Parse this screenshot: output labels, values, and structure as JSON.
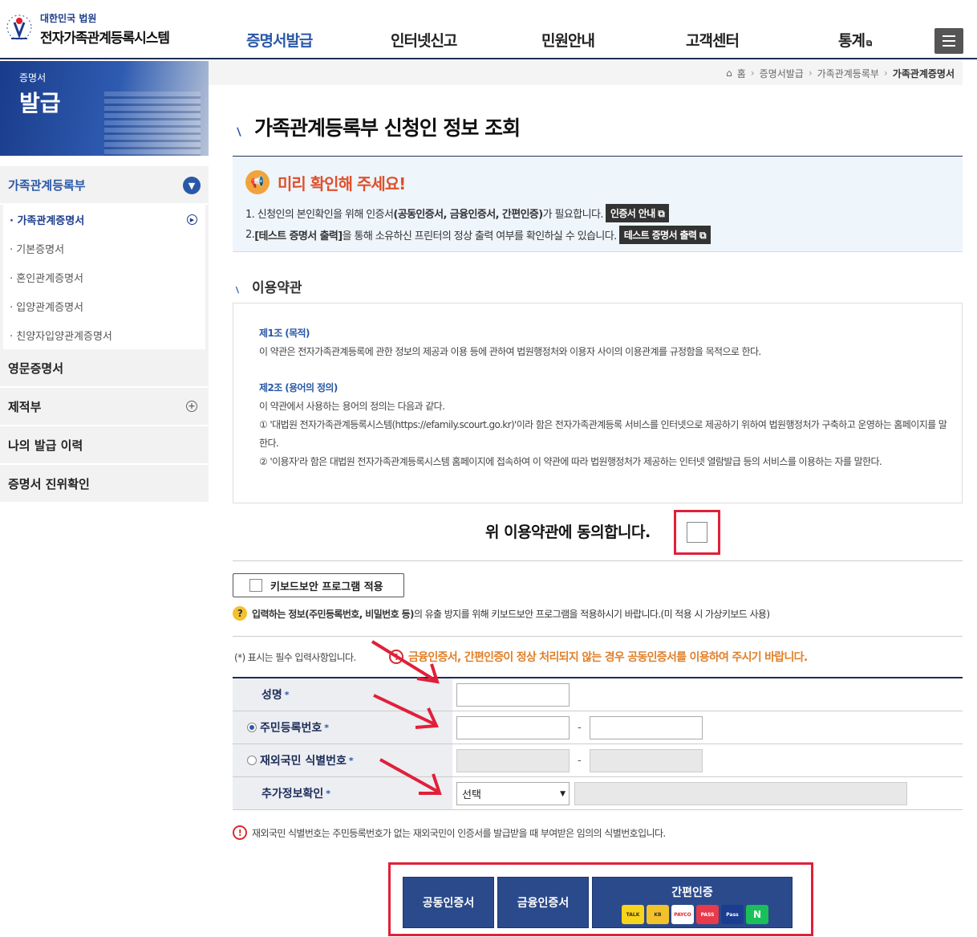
{
  "header": {
    "logo_sub": "대한민국 법원",
    "logo_main": "전자가족관계등록시스템",
    "nav": [
      {
        "label": "증명서발급",
        "active": true
      },
      {
        "label": "인터넷신고"
      },
      {
        "label": "민원안내"
      },
      {
        "label": "고객센터"
      },
      {
        "label": "통계"
      }
    ]
  },
  "banner": {
    "small": "증명서",
    "big": "발급"
  },
  "sidebar": {
    "categories": [
      {
        "label": "가족관계등록부",
        "expanded": true
      },
      {
        "label": "영문증명서"
      },
      {
        "label": "제적부"
      },
      {
        "label": "나의 발급 이력"
      },
      {
        "label": "증명서 진위확인"
      }
    ],
    "sub_items": [
      {
        "label": "· 가족관계증명서",
        "active": true
      },
      {
        "label": "· 기본증명서"
      },
      {
        "label": "· 혼인관계증명서"
      },
      {
        "label": "· 입양관계증명서"
      },
      {
        "label": "· 친양자입양관계증명서"
      }
    ]
  },
  "breadcrumb": [
    "홈",
    "증명서발급",
    "가족관계등록부",
    "가족관계증명서"
  ],
  "page_title": "가족관계등록부 신청인 정보 조회",
  "notice": {
    "title": "미리 확인해 주세요!",
    "line1_a": "1. 신청인의 본인확인을 위해 인증서",
    "line1_b": "(공동인증서, 금융인증서, 간편인증)",
    "line1_c": "가 필요합니다.",
    "line1_btn": "인증서 안내",
    "line2_a": "2. ",
    "line2_b": "[테스트 증명서 출력]",
    "line2_c": "을 통해 소유하신 프린터의 정상 출력 여부를 확인하실 수 있습니다.",
    "line2_btn": "테스트 증명서 출력"
  },
  "terms": {
    "heading": "이용약관",
    "art1_title": "제1조 (목적)",
    "art1_body": "이 약관은 전자가족관계등록에 관한 정보의 제공과 이용 등에 관하여 법원행정처와 이용자 사이의 이용관계를 규정함을 목적으로 한다.",
    "art2_title": "제2조 (용어의 정의)",
    "art2_intro": "이 약관에서 사용하는 용어의 정의는 다음과 같다.",
    "art2_item1": "① '대법원 전자가족관계등록시스템(https://efamily.scourt.go.kr)'이라 함은 전자가족관계등록 서비스를 인터넷으로 제공하기 위하여 법원행정처가 구축하고 운영하는 홈페이지를 말한다.",
    "art2_item2": "② '이용자'라 함은 대법원 전자가족관계등록시스템 홈페이지에 접속하여 이 약관에 따라 법원행정처가 제공하는 인터넷 열람발급 등의 서비스를 이용하는 자를 말한다.",
    "agree_label": "위 이용약관에 동의합니다."
  },
  "keyboard": {
    "button_label": "키보드보안 프로그램 적용",
    "note_bold": "입력하는 정보(주민등록번호, 비밀번호 등)",
    "note_rest": "의 유출 방지를 위해 키보드보안 프로그램을 적용하시기 바랍니다.(미 적용 시 가상키보드 사용)"
  },
  "form": {
    "required_note": "(*) 표시는 필수 입력사항입니다.",
    "warning": "금융인증서, 간편인증이 정상 처리되지 않는 경우 공동인증서를 이용하여 주시기 바랍니다.",
    "name_label": "성명",
    "rrn_label": "주민등록번호",
    "foreign_label": "재외국민 식별번호",
    "extra_label": "추가정보확인",
    "select_value": "선택",
    "dash": "-",
    "star": "*",
    "id_note": "재외국민 식별번호는 주민등록번호가 없는 재외국민이 인증서를 발급받을 때 부여받은 임의의 식별번호입니다."
  },
  "auth": {
    "joint": "공동인증서",
    "financial": "금융인증서",
    "easy": "간편인증",
    "providers": [
      "TALK",
      "KB",
      "PAYCO",
      "PASS",
      "Pass",
      "N"
    ]
  }
}
